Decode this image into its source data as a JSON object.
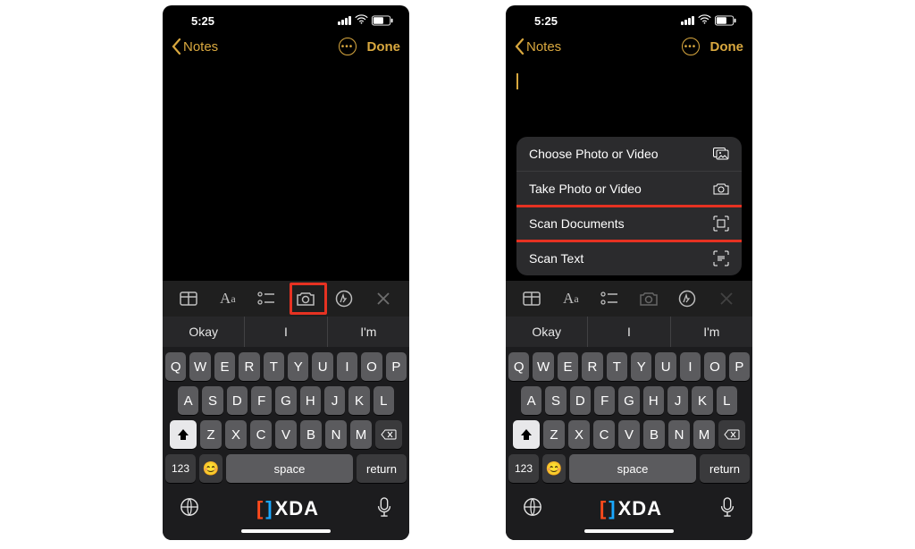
{
  "status": {
    "time": "5:25"
  },
  "nav": {
    "back_label": "Notes",
    "done_label": "Done"
  },
  "popup": {
    "items": [
      {
        "label": "Choose Photo or Video",
        "icon": "gallery"
      },
      {
        "label": "Take Photo or Video",
        "icon": "camera"
      },
      {
        "label": "Scan Documents",
        "icon": "scan-doc",
        "highlighted": true
      },
      {
        "label": "Scan Text",
        "icon": "scan-text"
      }
    ]
  },
  "toolbar": {
    "aa": "Aa"
  },
  "predictions": [
    "Okay",
    "I",
    "I'm"
  ],
  "keyboard": {
    "row1": [
      "Q",
      "W",
      "E",
      "R",
      "T",
      "Y",
      "U",
      "I",
      "O",
      "P"
    ],
    "row2": [
      "A",
      "S",
      "D",
      "F",
      "G",
      "H",
      "J",
      "K",
      "L"
    ],
    "row3": [
      "Z",
      "X",
      "C",
      "V",
      "B",
      "N",
      "M"
    ],
    "num_label": "123",
    "space_label": "space",
    "return_label": "return"
  },
  "watermark": "XDA"
}
